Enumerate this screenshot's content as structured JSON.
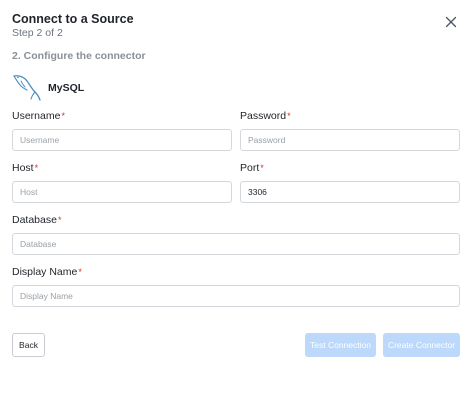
{
  "dialog": {
    "title": "Connect to a Source",
    "step": "Step 2 of 2",
    "section_title": "2. Configure the connector",
    "close_icon": "close-icon"
  },
  "connector": {
    "name": "MySQL",
    "logo_icon": "mysql-dolphin-logo"
  },
  "fields": {
    "username": {
      "label": "Username",
      "required": "*",
      "placeholder": "Username",
      "value": ""
    },
    "password": {
      "label": "Password",
      "required": "*",
      "placeholder": "Password",
      "value": ""
    },
    "host": {
      "label": "Host",
      "required": "*",
      "placeholder": "Host",
      "value": ""
    },
    "port": {
      "label": "Port",
      "required": "*",
      "placeholder": "",
      "value": "3306"
    },
    "database": {
      "label": "Database",
      "required": "*",
      "placeholder": "Database",
      "value": ""
    },
    "display_name": {
      "label": "Display Name",
      "required": "*",
      "placeholder": "Display Name",
      "value": ""
    }
  },
  "actions": {
    "back": "Back",
    "test": "Test Connection",
    "create": "Create Connector"
  },
  "colors": {
    "required": "#d93025",
    "primary_disabled": "#bcd8fb",
    "logo": "#4a8fbf"
  }
}
